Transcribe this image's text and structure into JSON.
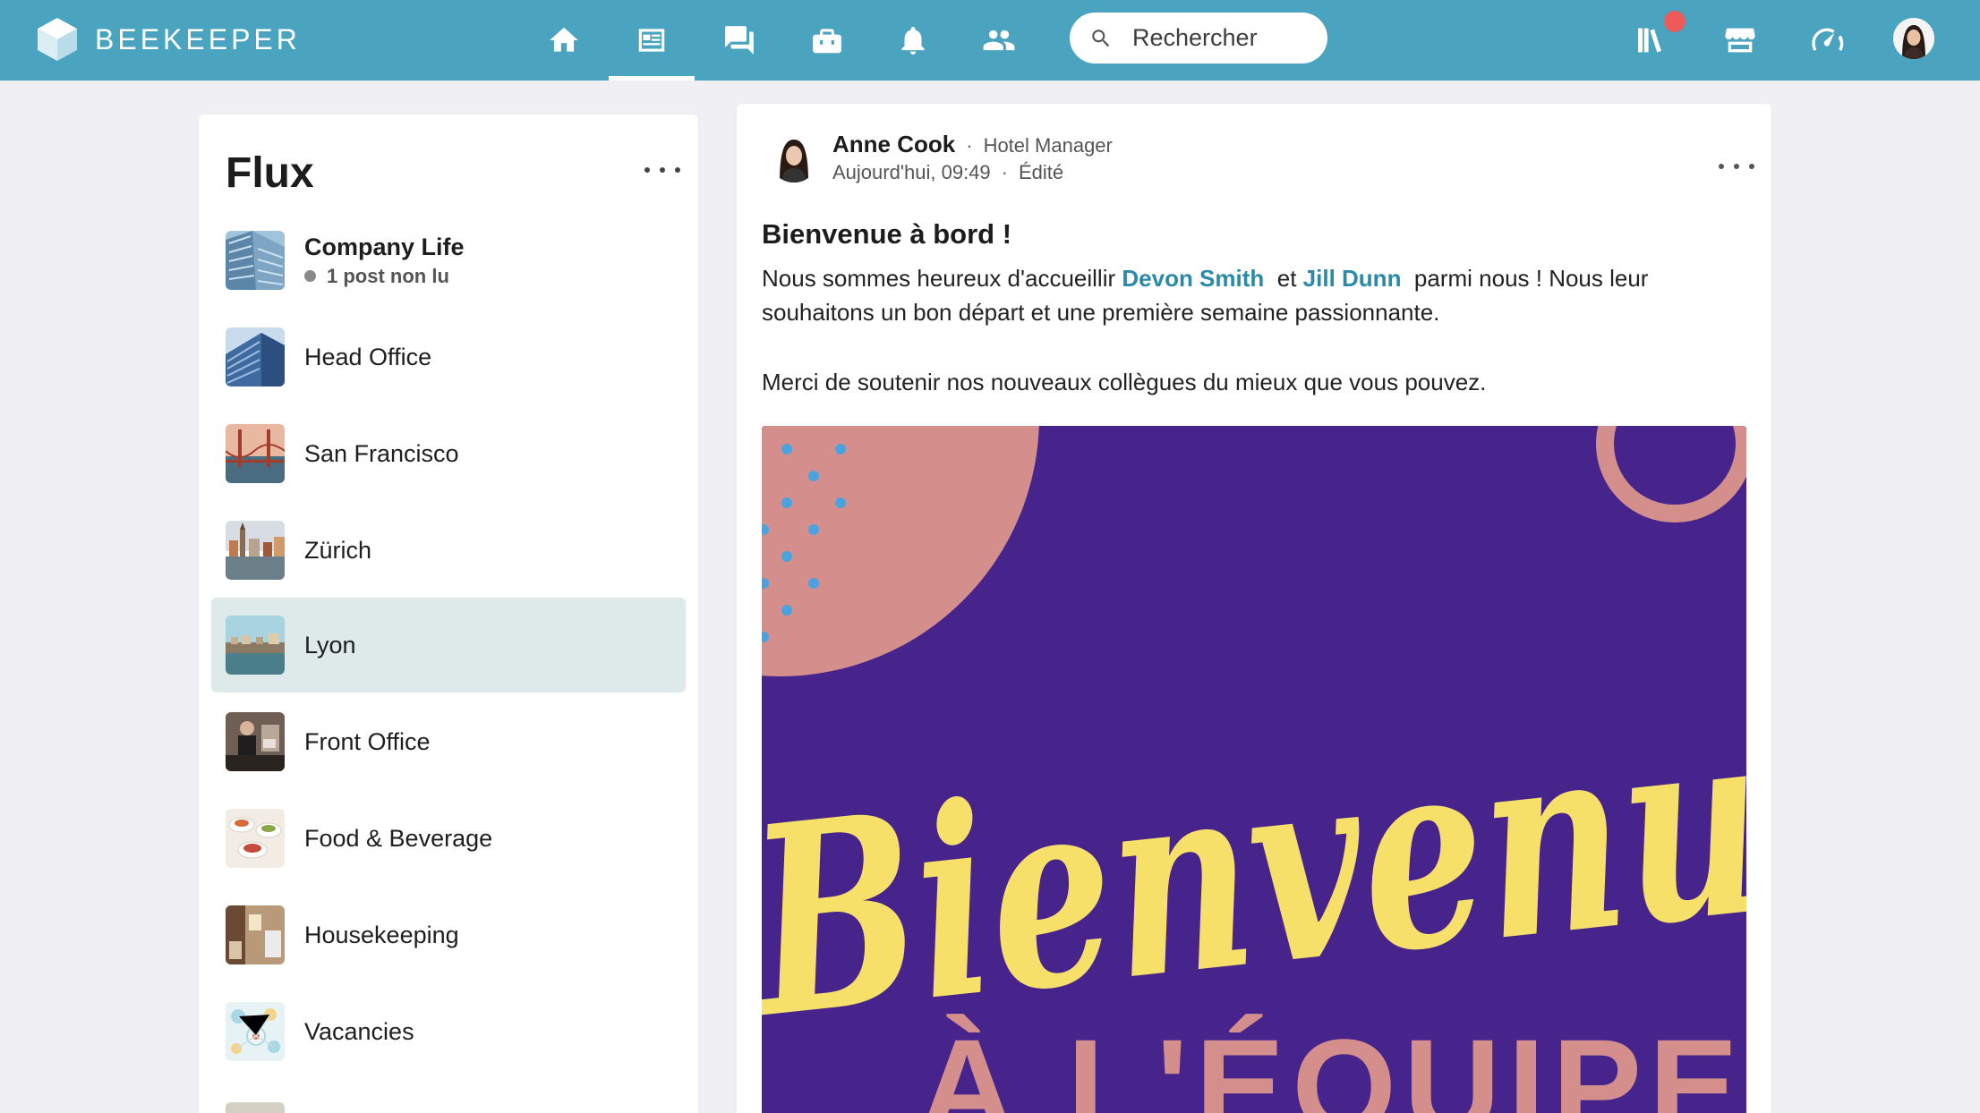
{
  "brand": {
    "name": "BEEKEEPER"
  },
  "nav": {
    "items": [
      {
        "name": "home-icon",
        "active": false
      },
      {
        "name": "streams-icon",
        "active": true
      },
      {
        "name": "chat-icon",
        "active": false
      },
      {
        "name": "toolbox-icon",
        "active": false
      },
      {
        "name": "bell-icon",
        "active": false
      },
      {
        "name": "people-icon",
        "active": false
      }
    ]
  },
  "search": {
    "placeholder": "Rechercher",
    "value": ""
  },
  "right_icons": [
    "library-icon",
    "marketplace-icon",
    "dashboard-icon"
  ],
  "colors": {
    "topbar": "#4aa3bf",
    "mention": "#2b8aa8",
    "selected_row": "#deeaea",
    "notification": "#ec5a5a",
    "banner_bg": "#46248c",
    "banner_pink": "#d48f8c",
    "banner_yellow": "#f7e06a",
    "banner_dots": "#4aa3e0"
  },
  "sidebar": {
    "title": "Flux",
    "streams": [
      {
        "label": "Company Life",
        "sub": "1 post non lu",
        "unread": true
      },
      {
        "label": "Head Office"
      },
      {
        "label": "San Francisco"
      },
      {
        "label": "Zürich"
      },
      {
        "label": "Lyon",
        "selected": true
      },
      {
        "label": "Front Office"
      },
      {
        "label": "Food & Beverage"
      },
      {
        "label": "Housekeeping"
      },
      {
        "label": "Vacancies"
      }
    ]
  },
  "post": {
    "author": "Anne Cook",
    "role": "Hotel Manager",
    "time": "Aujourd'hui, 09:49",
    "edited": "Édité",
    "title": "Bienvenue à bord !",
    "body": {
      "intro": "Nous sommes heureux d'accueillir",
      "mention1": "Devon Smith",
      "and": "et",
      "mention2": "Jill Dunn",
      "rest": "parmi nous ! Nous leur souhaitons un bon départ et une première semaine passionnante.",
      "paragraph2": "Merci de soutenir nos nouveaux collègues du mieux que vous pouvez."
    },
    "image": {
      "script_text": "Bienvenu",
      "subtitle": "À L'ÉQUIPE"
    }
  }
}
